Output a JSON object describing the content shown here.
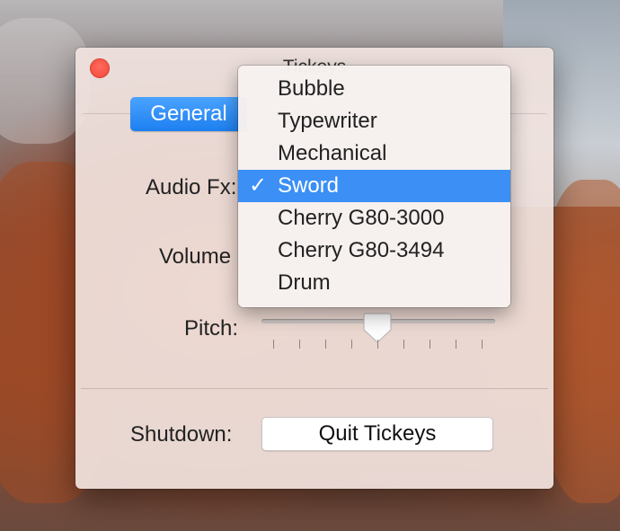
{
  "window": {
    "title": "Tickeys"
  },
  "tabs": [
    {
      "label": "General"
    }
  ],
  "fields": {
    "audio_fx_label": "Audio Fx:",
    "volume_label": "Volume",
    "pitch_label": "Pitch:",
    "shutdown_label": "Shutdown:"
  },
  "pitch_slider": {
    "value_fraction": 0.5,
    "ticks": 9
  },
  "quit_button": {
    "label": "Quit Tickeys"
  },
  "audio_fx_menu": {
    "items": [
      {
        "label": "Bubble",
        "checked": false
      },
      {
        "label": "Typewriter",
        "checked": false
      },
      {
        "label": "Mechanical",
        "checked": false
      },
      {
        "label": "Sword",
        "checked": true
      },
      {
        "label": "Cherry G80-3000",
        "checked": false
      },
      {
        "label": "Cherry G80-3494",
        "checked": false
      },
      {
        "label": "Drum",
        "checked": false
      }
    ],
    "check_glyph": "✓"
  },
  "colors": {
    "accent": "#3b8ff5",
    "close": "#f2493b"
  }
}
